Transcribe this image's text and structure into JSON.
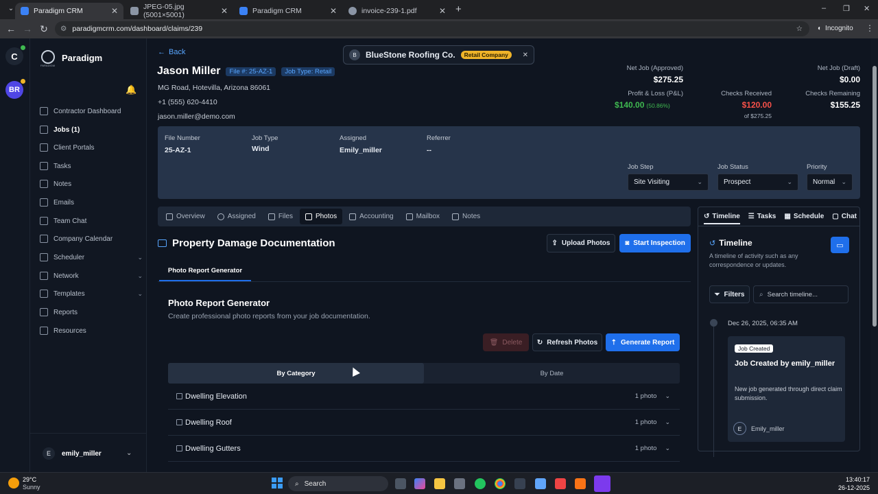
{
  "browser": {
    "tabs": [
      {
        "title": "Paradigm CRM",
        "active": true,
        "color": "#3b82f6"
      },
      {
        "title": "JPEG-05.jpg (5001×5001)",
        "active": false,
        "color": "#8b95a5"
      },
      {
        "title": "Paradigm CRM",
        "active": false,
        "color": "#3b82f6"
      },
      {
        "title": "invoice-239-1.pdf",
        "active": false,
        "color": "#8b95a5"
      }
    ],
    "new_tab": "+",
    "url": "paradigmcrm.com/dashboard/claims/239",
    "incognito": "Incognito",
    "window_controls": [
      "–",
      "❐",
      "✕"
    ]
  },
  "rail": {
    "top_avatar": "C",
    "second_avatar": "BR"
  },
  "sidebar": {
    "brand": "Paradigm",
    "brand_sub": "PARADIGM",
    "items": [
      {
        "label": "Contractor Dashboard",
        "active": false
      },
      {
        "label": "Jobs (1)",
        "active": true
      },
      {
        "label": "Client Portals",
        "active": false
      },
      {
        "label": "Tasks",
        "active": false
      },
      {
        "label": "Notes",
        "active": false
      },
      {
        "label": "Emails",
        "active": false
      },
      {
        "label": "Team Chat",
        "active": false
      },
      {
        "label": "Company Calendar",
        "active": false
      },
      {
        "label": "Scheduler",
        "active": false,
        "expandable": true
      },
      {
        "label": "Network",
        "active": false,
        "expandable": true
      },
      {
        "label": "Templates",
        "active": false,
        "expandable": true
      },
      {
        "label": "Reports",
        "active": false
      },
      {
        "label": "Resources",
        "active": false
      }
    ],
    "user_initial": "E",
    "user_name": "emily_miller"
  },
  "company_chip": {
    "initial": "B",
    "name": "BlueStone Roofing Co.",
    "badge": "Retail Company",
    "close": "✕"
  },
  "job": {
    "back": "Back",
    "client_name": "Jason Miller",
    "file_badge": "File #: 25-AZ-1",
    "type_badge": "Job Type: Retail",
    "address": "MG Road, Hotevilla, Arizona 86061",
    "phone": "+1 (555) 620-4410",
    "email": "jason.miller@demo.com"
  },
  "financials": {
    "net_job_approved_label": "Net Job (Approved)",
    "net_job_approved": "$275.25",
    "net_job_draft_label": "Net Job (Draft)",
    "net_job_draft": "$0.00",
    "pl_label": "Profit & Loss (P&L)",
    "pl_value": "$140.00",
    "pl_pct": "(50.86%)",
    "checks_received_label": "Checks Received",
    "checks_received": "$120.00",
    "checks_received_of": "of $275.25",
    "checks_remaining_label": "Checks Remaining",
    "checks_remaining": "$155.25",
    "colors": {
      "green": "#3fb950",
      "red": "#f85149"
    }
  },
  "details": {
    "file_number_label": "File Number",
    "file_number": "25-AZ-1",
    "job_type_label": "Job Type",
    "job_type": "Wind",
    "assigned_label": "Assigned",
    "assigned": "Emily_miller",
    "referrer_label": "Referrer",
    "referrer": "--",
    "job_step_label": "Job Step",
    "job_step": "Site Visiting",
    "job_status_label": "Job Status",
    "job_status": "Prospect",
    "priority_label": "Priority",
    "priority": "Normal"
  },
  "tabs": [
    {
      "label": "Overview",
      "active": false,
      "icon": "grid-icon"
    },
    {
      "label": "Assigned",
      "active": false,
      "icon": "users-icon"
    },
    {
      "label": "Files",
      "active": false,
      "icon": "file-icon"
    },
    {
      "label": "Photos",
      "active": true,
      "icon": "image-icon"
    },
    {
      "label": "Accounting",
      "active": false,
      "icon": "calculator-icon"
    },
    {
      "label": "Mailbox",
      "active": false,
      "icon": "mail-icon"
    },
    {
      "label": "Notes",
      "active": false,
      "icon": "note-icon"
    }
  ],
  "photos": {
    "section_title": "Property Damage Documentation",
    "upload_btn": "Upload Photos",
    "inspect_btn": "Start Inspection",
    "subtab": "Photo Report Generator",
    "gen_title": "Photo Report Generator",
    "gen_desc": "Create professional photo reports from your job documentation.",
    "delete_btn": "Delete",
    "refresh_btn": "Refresh Photos",
    "generate_btn": "Generate Report",
    "view_by_category": "By Category",
    "view_by_date": "By Date",
    "categories": [
      {
        "name": "Dwelling Elevation",
        "count": "1 photo"
      },
      {
        "name": "Dwelling Roof",
        "count": "1 photo"
      },
      {
        "name": "Dwelling Gutters",
        "count": "1 photo"
      }
    ]
  },
  "timeline": {
    "tabs": [
      "Timeline",
      "Tasks",
      "Schedule",
      "Chat"
    ],
    "title": "Timeline",
    "desc": "A timeline of activity such as any correspondence or updates.",
    "filters": "Filters",
    "search_placeholder": "Search timeline...",
    "entry": {
      "date": "Dec 26, 2025, 06:35 AM",
      "badge": "Job Created",
      "title": "Job Created by emily_miller",
      "body": "New job generated through direct claim submission.",
      "user_initial": "E",
      "user": "Emily_miller"
    }
  },
  "taskbar": {
    "temp": "29°C",
    "weather": "Sunny",
    "search": "Search",
    "time": "13:40:17",
    "date": "26-12-2025"
  }
}
